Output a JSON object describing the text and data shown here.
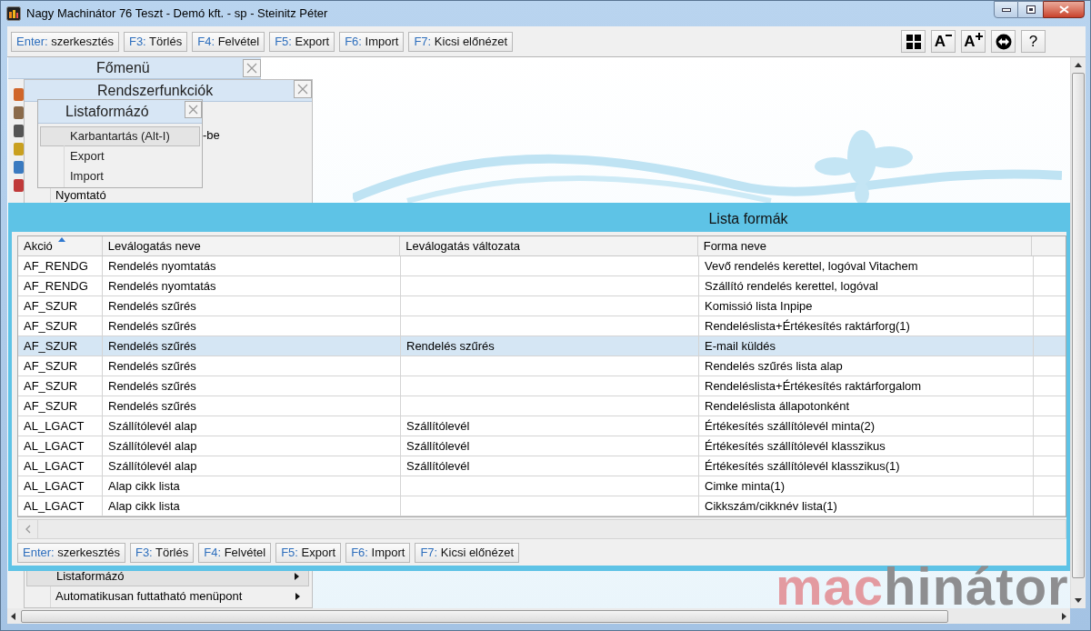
{
  "window": {
    "title": "Nagy Machinátor 76 Teszt - Demó kft. - sp - Steinitz Péter"
  },
  "toolbar": {
    "buttons": [
      {
        "key": "Enter:",
        "label": "szerkesztés"
      },
      {
        "key": "F3:",
        "label": "Törlés"
      },
      {
        "key": "F4:",
        "label": "Felvétel"
      },
      {
        "key": "F5:",
        "label": "Export"
      },
      {
        "key": "F6:",
        "label": "Import"
      },
      {
        "key": "F7:",
        "label": "Kicsi előnézet"
      }
    ],
    "font_buttons": [
      {
        "label": "A",
        "kind": "decrease"
      },
      {
        "label": "A",
        "kind": "increase"
      }
    ],
    "help_button": "?"
  },
  "main_menu": {
    "title": "Főmenü"
  },
  "system_menu": {
    "title": "Rendszerfunkciók",
    "items": [
      {
        "label": "-be",
        "selected": false,
        "submenu": false
      },
      {
        "label": "Nyomtató",
        "selected": false,
        "submenu": false
      },
      {
        "label": "Listaformázó",
        "selected": true,
        "submenu": true
      },
      {
        "label": "Automatikusan futtatható menüpont",
        "selected": false,
        "submenu": true
      }
    ]
  },
  "list_menu": {
    "title": "Listaformázó",
    "items": [
      {
        "label": "Karbantartás (Alt-I)",
        "selected": true
      },
      {
        "label": "Export",
        "selected": false
      },
      {
        "label": "Import",
        "selected": false
      }
    ]
  },
  "dialog": {
    "title": "Lista formák",
    "columns": [
      {
        "label": "Akció",
        "sorted": true
      },
      {
        "label": "Leválogatás neve",
        "sorted": false
      },
      {
        "label": "Leválogatás változata",
        "sorted": false
      },
      {
        "label": "Forma neve",
        "sorted": false
      }
    ],
    "rows": [
      {
        "cells": [
          "AF_RENDG",
          "Rendelés nyomtatás",
          "",
          "Vevő rendelés kerettel, logóval Vitachem"
        ],
        "selected": false
      },
      {
        "cells": [
          "AF_RENDG",
          "Rendelés nyomtatás",
          "",
          "Szállító rendelés kerettel, logóval"
        ],
        "selected": false
      },
      {
        "cells": [
          "AF_SZUR",
          "Rendelés szűrés",
          "",
          "Komissió lista Inpipe"
        ],
        "selected": false
      },
      {
        "cells": [
          "AF_SZUR",
          "Rendelés szűrés",
          "",
          "Rendeléslista+Értékesítés raktárforg(1)"
        ],
        "selected": false
      },
      {
        "cells": [
          "AF_SZUR",
          "Rendelés szűrés",
          "Rendelés szűrés",
          "E-mail küldés"
        ],
        "selected": true
      },
      {
        "cells": [
          "AF_SZUR",
          "Rendelés szűrés",
          "",
          "Rendelés szűrés lista alap"
        ],
        "selected": false
      },
      {
        "cells": [
          "AF_SZUR",
          "Rendelés szűrés",
          "",
          "Rendeléslista+Értékesítés raktárforgalom"
        ],
        "selected": false
      },
      {
        "cells": [
          "AF_SZUR",
          "Rendelés szűrés",
          "",
          "Rendeléslista állapotonként"
        ],
        "selected": false
      },
      {
        "cells": [
          "AL_LGACT",
          "Szállítólevél alap",
          "Szállítólevél",
          "Értékesítés szállítólevél minta(2)"
        ],
        "selected": false
      },
      {
        "cells": [
          "AL_LGACT",
          "Szállítólevél alap",
          "Szállítólevél",
          "Értékesítés szállítólevél klasszikus"
        ],
        "selected": false
      },
      {
        "cells": [
          "AL_LGACT",
          "Szállítólevél alap",
          "Szállítólevél",
          "Értékesítés szállítólevél klasszikus(1)"
        ],
        "selected": false
      },
      {
        "cells": [
          "AL_LGACT",
          "Alap cikk lista",
          "",
          "Cimke minta(1)"
        ],
        "selected": false
      },
      {
        "cells": [
          "AL_LGACT",
          "Alap cikk lista",
          "",
          "Cikkszám/cikknév lista(1)"
        ],
        "selected": false
      }
    ],
    "buttons": [
      {
        "key": "Enter:",
        "label": "szerkesztés"
      },
      {
        "key": "F3:",
        "label": "Törlés"
      },
      {
        "key": "F4:",
        "label": "Felvétel"
      },
      {
        "key": "F5:",
        "label": "Export"
      },
      {
        "key": "F6:",
        "label": "Import"
      },
      {
        "key": "F7:",
        "label": "Kicsi előnézet"
      }
    ]
  },
  "logo": {
    "parts": [
      "mac",
      "hinátor"
    ]
  }
}
